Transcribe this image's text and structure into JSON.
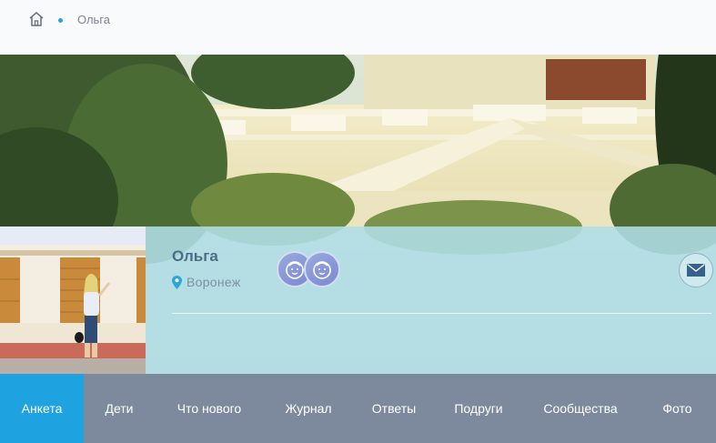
{
  "breadcrumb": {
    "home_icon": "home-icon",
    "current": "Ольга"
  },
  "cover": {
    "description_icon": "cover-photo"
  },
  "profile": {
    "name": "Ольга",
    "city": "Воронеж",
    "city_icon": "location-pin-icon",
    "children_badges": [
      "kid-icon",
      "kid-icon"
    ],
    "message_icon": "mail-icon",
    "accent_color": "#1fa3e0"
  },
  "tabs": [
    {
      "label": "Анкета",
      "active": true
    },
    {
      "label": "Дети",
      "active": false
    },
    {
      "label": "Что нового",
      "active": false
    },
    {
      "label": "Журнал",
      "active": false
    },
    {
      "label": "Ответы",
      "active": false
    },
    {
      "label": "Подруги",
      "active": false
    },
    {
      "label": "Сообщества",
      "active": false
    },
    {
      "label": "Фото",
      "active": false
    }
  ]
}
